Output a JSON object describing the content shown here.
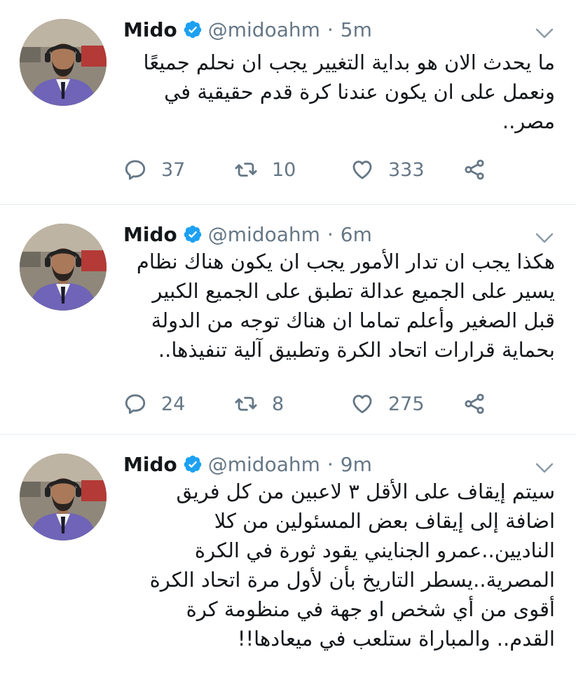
{
  "colors": {
    "name": "#14171a",
    "meta": "#657786",
    "verified": "#1da1f2",
    "divider": "#e6ecf0"
  },
  "tweets": [
    {
      "name": "Mido",
      "handle": "@midoahm",
      "separator": "·",
      "time": "5m",
      "text": "ما يحدث الان هو بداية التغيير يجب ان نحلم جميعًا ونعمل على ان يكون عندنا كرة قدم حقيقية في مصر..",
      "replies": "37",
      "retweets": "10",
      "likes": "333"
    },
    {
      "name": "Mido",
      "handle": "@midoahm",
      "separator": "·",
      "time": "6m",
      "text": "هكذا يجب ان تدار الأمور يجب ان يكون هناك نظام يسير على الجميع عدالة تطبق على الجميع الكبير قبل الصغير وأعلم تماما ان هناك توجه من الدولة بحماية قرارات اتحاد الكرة وتطبيق آلية تنفيذها..",
      "replies": "24",
      "retweets": "8",
      "likes": "275"
    },
    {
      "name": "Mido",
      "handle": "@midoahm",
      "separator": "·",
      "time": "9m",
      "text": "سيتم إيقاف على الأقل ٣ لاعبين من كل فريق اضافة إلى إيقاف بعض المسئولين من كلا الناديين..عمرو الجنايني يقود ثورة في الكرة المصرية..يسطر التاريخ بأن لأول مرة اتحاد الكرة أقوى من أي شخص او جهة في منظومة كرة القدم.. والمباراة ستلعب في ميعادها!!"
    }
  ]
}
